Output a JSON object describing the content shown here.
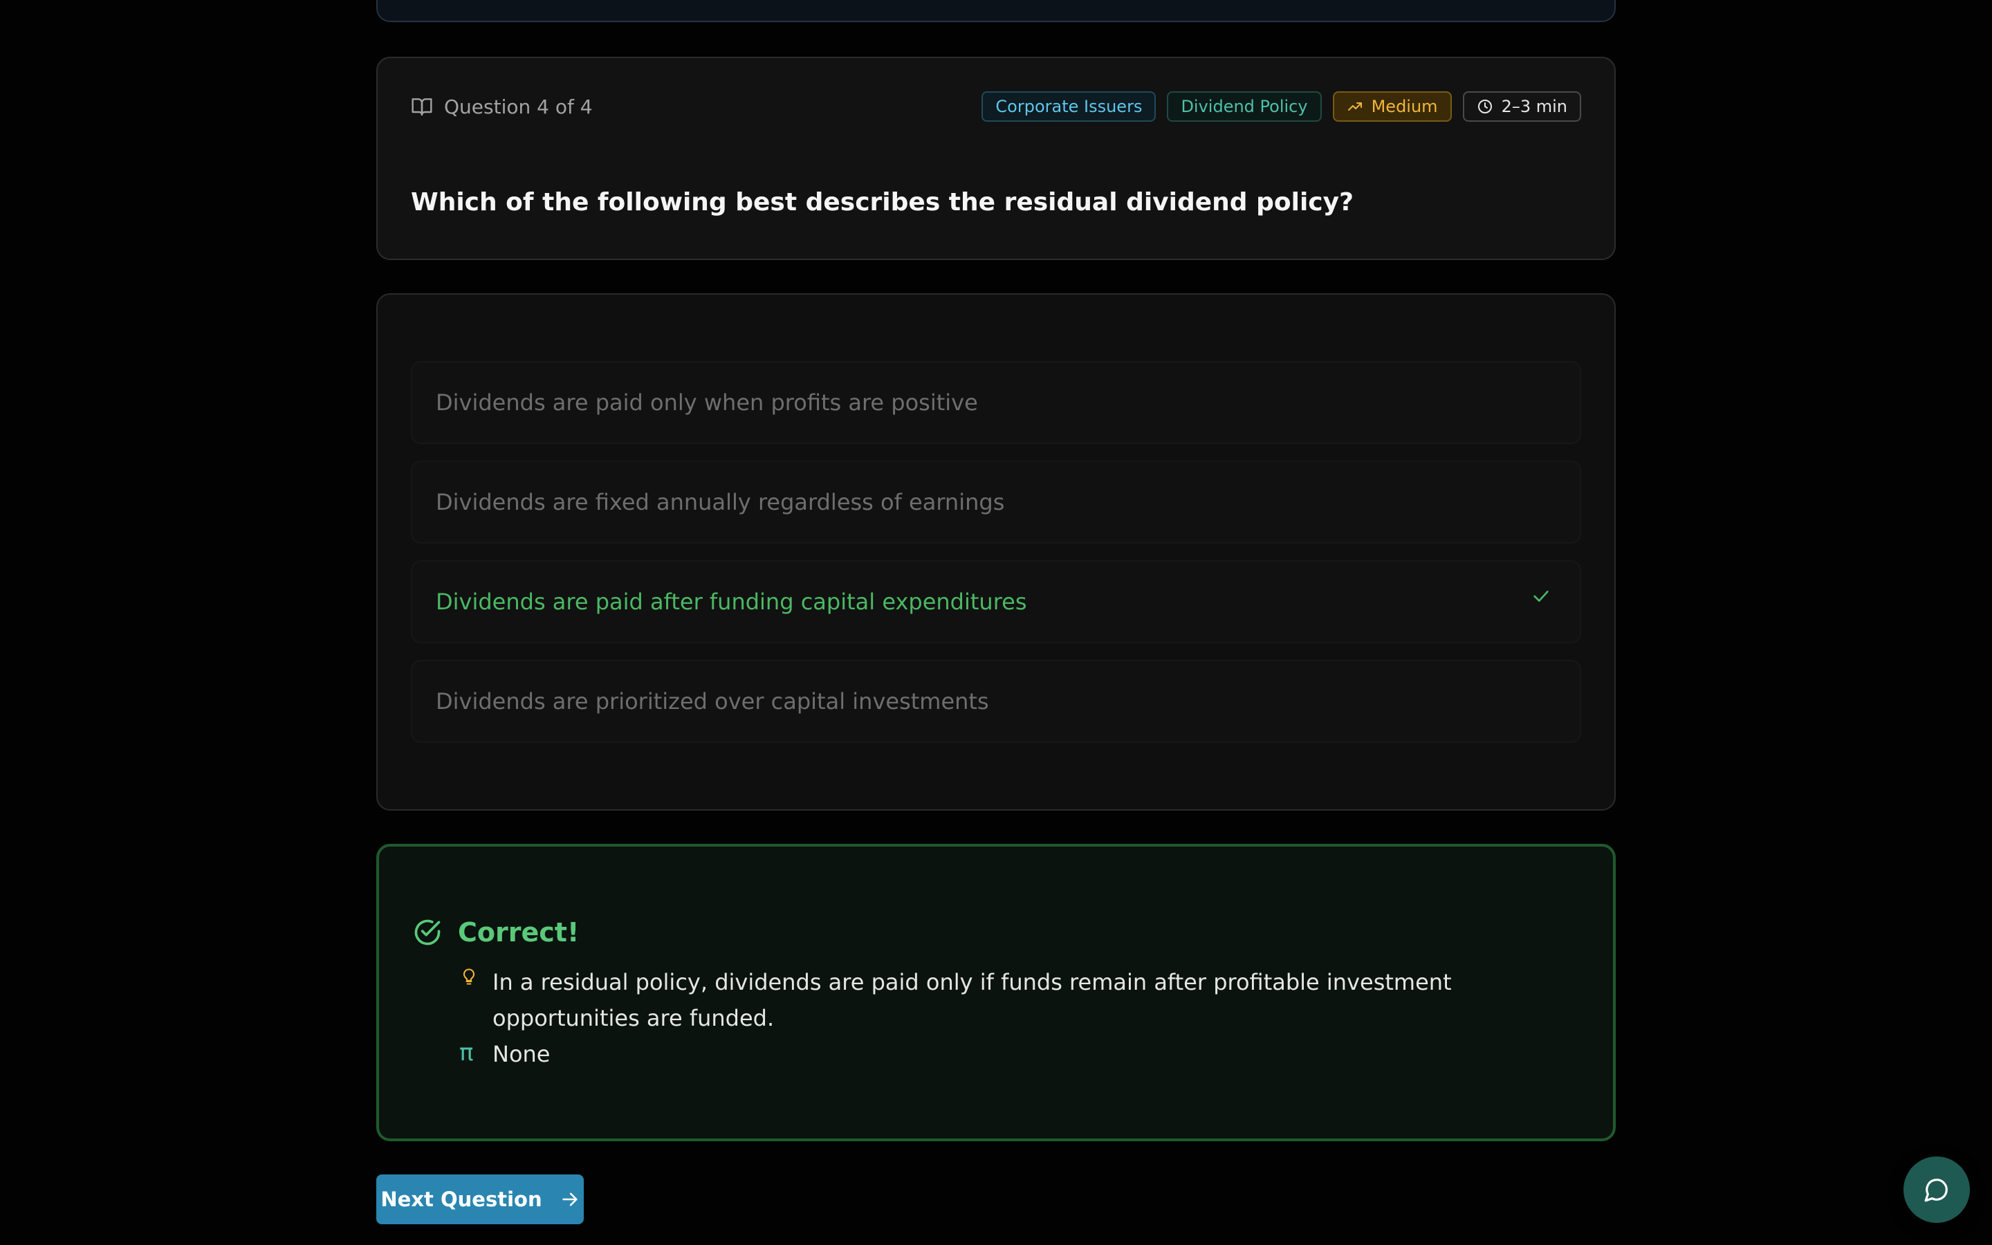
{
  "question": {
    "counter": "Question 4 of 4",
    "text": "Which of the following best describes the residual dividend policy?",
    "tags": {
      "topic": "Corporate Issuers",
      "subtopic": "Dividend Policy",
      "difficulty": "Medium",
      "time": "2–3 min"
    }
  },
  "options": [
    {
      "label": "Dividends are paid only when profits are positive",
      "state": "neutral"
    },
    {
      "label": "Dividends are fixed annually regardless of earnings",
      "state": "neutral"
    },
    {
      "label": "Dividends are paid after funding capital expenditures",
      "state": "correct"
    },
    {
      "label": "Dividends are prioritized over capital investments",
      "state": "neutral"
    }
  ],
  "feedback": {
    "title": "Correct!",
    "explanation": "In a residual policy, dividends are paid only if funds remain after profitable investment opportunities are funded.",
    "formula": "None",
    "icons": {
      "title": "check-circle-icon",
      "explanation": "lightbulb-icon",
      "formula": "pi-icon"
    }
  },
  "actions": {
    "next_label": "Next Question"
  },
  "colors": {
    "accent": "#2a86b0",
    "correct": "#5ac97a",
    "difficulty": "#f2b53a"
  }
}
